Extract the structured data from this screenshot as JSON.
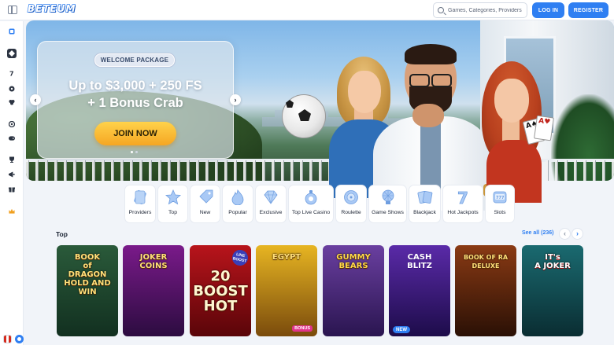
{
  "header": {
    "logo": "BETEUM",
    "search_placeholder": "Games, Categories, Providers",
    "login_label": "LOG IN",
    "register_label": "REGISTER"
  },
  "sidebar": {
    "icons": [
      "casino-icon",
      "live-casino-icon",
      "slots-icon",
      "roulette-icon",
      "blackjack-icon",
      "sports-icon",
      "esports-icon",
      "trophy-icon",
      "promotions-icon",
      "gift-icon",
      "vip-crown-icon"
    ],
    "language": "CA"
  },
  "hero": {
    "tag": "WELCOME PACKAGE",
    "title_line1": "Up to $3,000 + 250 FS",
    "title_line2": "+ 1 Bonus Crab",
    "cta": "JOIN NOW",
    "slides": 2,
    "active_slide": 1
  },
  "categories": [
    {
      "label": "Providers",
      "icon": "providers-icon"
    },
    {
      "label": "Top",
      "icon": "star-icon"
    },
    {
      "label": "New",
      "icon": "new-tag-icon"
    },
    {
      "label": "Popular",
      "icon": "fire-icon"
    },
    {
      "label": "Exclusive",
      "icon": "diamond-icon"
    },
    {
      "label": "Top Live Casino",
      "icon": "live-casino-icon"
    },
    {
      "label": "Roulette",
      "icon": "roulette-icon"
    },
    {
      "label": "Game Shows",
      "icon": "game-show-icon"
    },
    {
      "label": "Blackjack",
      "icon": "cards-icon"
    },
    {
      "label": "Hot Jackpots",
      "icon": "jackpot-icon"
    },
    {
      "label": "Slots",
      "icon": "slots-icon"
    }
  ],
  "section": {
    "title": "Top",
    "see_all": "See all (236)"
  },
  "games": [
    {
      "title": "BOOK\nof\nDRAGON\nHOLD AND WIN",
      "colors": [
        "#2a5a3a",
        "#123020"
      ]
    },
    {
      "title": "JOKER\nCOINS",
      "colors": [
        "#7a1a8a",
        "#2c0c40"
      ]
    },
    {
      "title": "20\nBOOST\nHOT",
      "colors": [
        "#b8141b",
        "#5a0509"
      ],
      "badge": "LINE BOOST"
    },
    {
      "title": "EGYPT",
      "colors": [
        "#e7b522",
        "#7a4b0c"
      ],
      "badge": "BONUS"
    },
    {
      "title": "GUMMY\nBEARS",
      "colors": [
        "#6a3fa0",
        "#2a1550"
      ]
    },
    {
      "title": "CASH\nBLITZ",
      "colors": [
        "#5a2aa8",
        "#1d0c4a"
      ],
      "badge": "NEW"
    },
    {
      "title": "BOOK OF RA\nDELUXE",
      "colors": [
        "#8a3a14",
        "#2a1005"
      ]
    },
    {
      "title": "IT's\nA JOKER",
      "colors": [
        "#1a6a70",
        "#0a2d32"
      ]
    }
  ]
}
